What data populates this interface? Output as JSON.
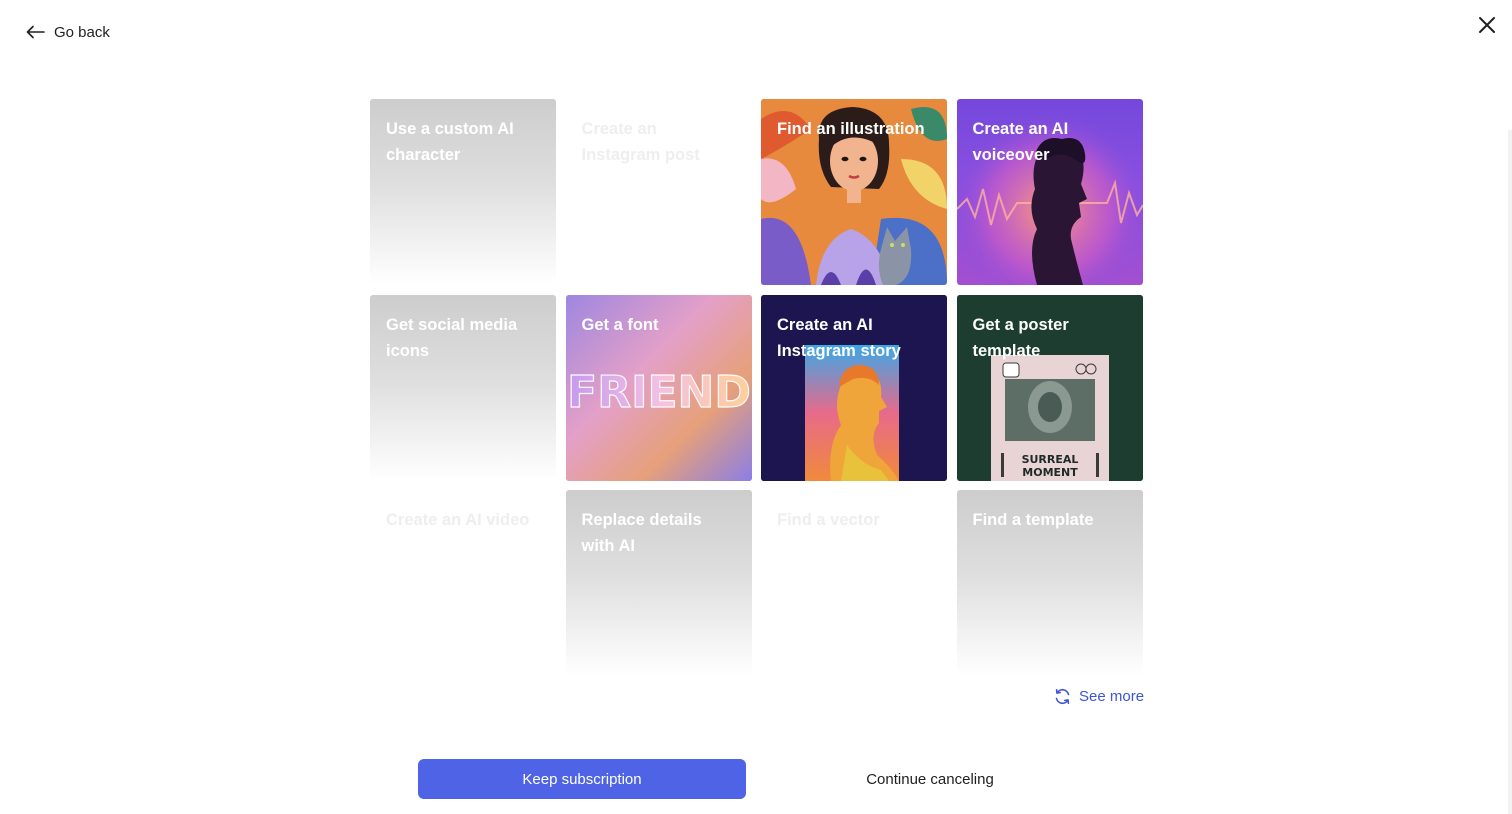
{
  "nav": {
    "go_back_label": "Go back",
    "close_icon": "close-icon",
    "back_icon": "arrow-left-icon"
  },
  "cards": [
    {
      "label": "Use a custom AI character",
      "style": "placeholder"
    },
    {
      "label": "Create an Instagram post",
      "style": "faded"
    },
    {
      "label": "Find an illustration",
      "style": "image"
    },
    {
      "label": "Create an AI voiceover",
      "style": "image"
    },
    {
      "label": "Get social media icons",
      "style": "placeholder"
    },
    {
      "label": "Get a font",
      "style": "image",
      "image_text": "FRIEND"
    },
    {
      "label": "Create an AI Instagram story",
      "style": "image"
    },
    {
      "label": "Get a poster template",
      "style": "image",
      "image_text": "SURREAL MOMENT"
    },
    {
      "label": "Create an AI video",
      "style": "faded"
    },
    {
      "label": "Replace details with AI",
      "style": "placeholder"
    },
    {
      "label": "Find a vector",
      "style": "faded"
    },
    {
      "label": "Find a template",
      "style": "placeholder"
    }
  ],
  "see_more": {
    "label": "See more",
    "icon": "refresh-icon"
  },
  "actions": {
    "keep_label": "Keep subscription",
    "continue_label": "Continue canceling"
  },
  "colors": {
    "accent": "#4e63e6",
    "link": "#3d55d8"
  }
}
